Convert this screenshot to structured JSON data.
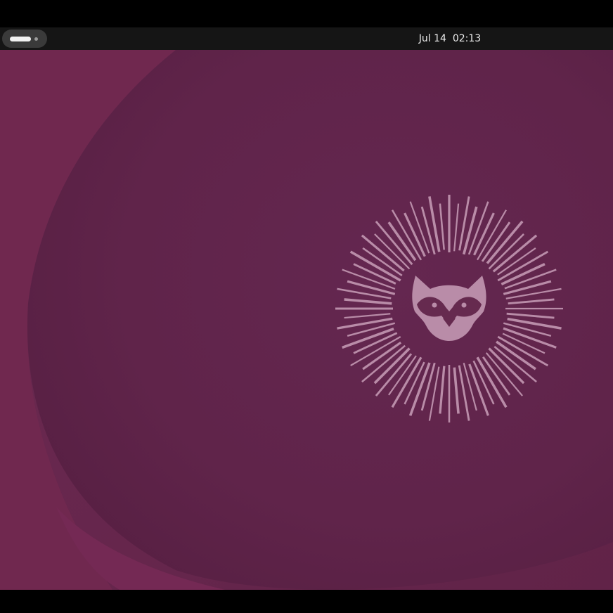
{
  "topbar": {
    "date": "Jul 14",
    "time": "02:13"
  },
  "icons": {
    "activities": "workspace-indicator-icon",
    "logo": "raccoon-mascot-icon"
  },
  "colors": {
    "wallpaper_base": "#662a4f",
    "wallpaper_accent": "#742954",
    "wallpaper_shadow": "#5a2143",
    "logo_color": "#b98ca8",
    "topbar_bg": "#151515"
  }
}
